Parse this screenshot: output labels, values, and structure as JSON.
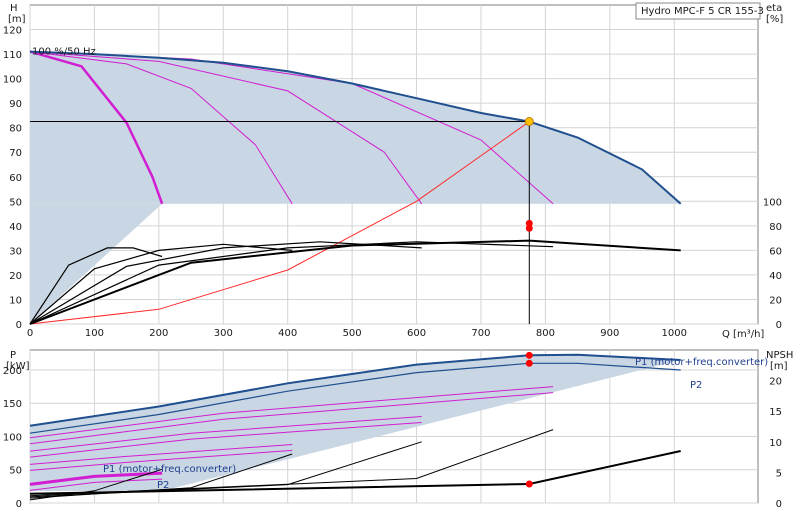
{
  "chart_data": [
    {
      "type": "line",
      "title": "Hydro MPC-F 5 CR 155-3",
      "ylabel_left": "H",
      "ylabel_left_unit": "[m]",
      "ylabel_right": "eta",
      "ylabel_right_unit": "[%]",
      "xlabel": "Q [m³/h]",
      "xlim": [
        0,
        1130
      ],
      "ylim": [
        0,
        130
      ],
      "grid": true,
      "x_ticks": [
        0,
        100,
        200,
        300,
        400,
        500,
        600,
        700,
        800,
        900,
        1000
      ],
      "y_ticks": [
        0,
        10,
        20,
        30,
        40,
        50,
        60,
        70,
        80,
        90,
        100,
        110,
        120
      ],
      "eta_ticks": [
        0,
        20,
        40,
        60,
        80,
        100
      ],
      "speed_label": "100 %/50 Hz",
      "operating_point": {
        "q": 775,
        "h": 82.5
      },
      "operating_head_line": 82.5,
      "eta_points": [
        {
          "q": 775,
          "eta": 82
        },
        {
          "q": 775,
          "eta": 78
        }
      ],
      "max_curve": {
        "x": [
          0,
          100,
          200,
          300,
          400,
          500,
          600,
          700,
          775,
          850,
          950,
          1010
        ],
        "y": [
          111,
          110,
          108.5,
          106.5,
          103,
          98,
          92,
          86,
          82.5,
          76,
          63,
          49
        ]
      },
      "reduced_speed_curves": [
        {
          "x": [
            0,
            80,
            150,
            190,
            205
          ],
          "y": [
            111,
            105,
            82,
            60,
            49
          ]
        },
        {
          "x": [
            0,
            150,
            250,
            350,
            407
          ],
          "y": [
            111,
            106,
            96,
            73,
            49
          ]
        },
        {
          "x": [
            0,
            200,
            400,
            550,
            608
          ],
          "y": [
            111,
            107,
            95,
            70,
            49
          ]
        },
        {
          "x": [
            0,
            250,
            500,
            700,
            812
          ],
          "y": [
            111,
            108,
            98,
            75,
            49
          ]
        }
      ],
      "system_curve": {
        "x": [
          0,
          200,
          400,
          600,
          775
        ],
        "y": [
          0,
          6,
          22,
          50,
          82.5
        ]
      },
      "eta_curves": [
        {
          "x": [
            0,
            60,
            120,
            160,
            205
          ],
          "y": [
            0,
            48,
            62,
            62,
            55
          ]
        },
        {
          "x": [
            0,
            100,
            200,
            300,
            407
          ],
          "y": [
            0,
            45,
            60,
            65,
            60
          ]
        },
        {
          "x": [
            0,
            150,
            300,
            450,
            608
          ],
          "y": [
            0,
            47,
            62,
            67,
            62
          ]
        },
        {
          "x": [
            0,
            200,
            400,
            600,
            812
          ],
          "y": [
            0,
            48,
            62,
            67,
            63
          ]
        },
        {
          "x": [
            0,
            250,
            500,
            775,
            1010
          ],
          "y": [
            0,
            50,
            64,
            68,
            60
          ]
        }
      ]
    },
    {
      "type": "line",
      "ylabel_left": "P",
      "ylabel_left_unit": "[kW]",
      "ylabel_right": "NPSH",
      "ylabel_right_unit": "[m]",
      "xlim": [
        0,
        1130
      ],
      "ylim": [
        0,
        230
      ],
      "y_ticks": [
        0,
        50,
        100,
        150,
        200
      ],
      "npsh_ticks": [
        0,
        5,
        10,
        15,
        20
      ],
      "label_p1": "P1 (motor+freq.converter)",
      "label_p2": "P2",
      "p1_points": [
        {
          "q": 775,
          "p": 222
        }
      ],
      "p2_points": [
        {
          "q": 775,
          "p": 210
        }
      ],
      "npsh_points": [
        {
          "q": 775,
          "npsh": 3.1
        }
      ],
      "p1_max": {
        "x": [
          0,
          200,
          400,
          600,
          775,
          850,
          1010
        ],
        "y": [
          116,
          145,
          180,
          208,
          222,
          223,
          215
        ]
      },
      "p2_max": {
        "x": [
          0,
          200,
          400,
          600,
          775,
          850,
          1010
        ],
        "y": [
          105,
          133,
          168,
          196,
          210,
          210,
          200
        ]
      },
      "p_reduced_curves": [
        {
          "x": [
            0,
            100,
            205
          ],
          "y": [
            28,
            40,
            45
          ]
        },
        {
          "x": [
            0,
            150,
            407
          ],
          "y": [
            58,
            70,
            88
          ]
        },
        {
          "x": [
            0,
            250,
            608
          ],
          "y": [
            78,
            105,
            130
          ]
        },
        {
          "x": [
            0,
            300,
            812
          ],
          "y": [
            98,
            135,
            175
          ]
        }
      ],
      "npsh_curves": [
        {
          "x": [
            0,
            100,
            205
          ],
          "y": [
            0.5,
            2,
            5.5
          ]
        },
        {
          "x": [
            0,
            250,
            407
          ],
          "y": [
            0.8,
            2.5,
            8
          ]
        },
        {
          "x": [
            0,
            400,
            608
          ],
          "y": [
            1,
            3,
            10
          ]
        },
        {
          "x": [
            0,
            600,
            812
          ],
          "y": [
            1.2,
            4,
            12
          ]
        },
        {
          "x": [
            0,
            775,
            1010
          ],
          "y": [
            1.5,
            3.1,
            8.5
          ]
        }
      ]
    }
  ]
}
